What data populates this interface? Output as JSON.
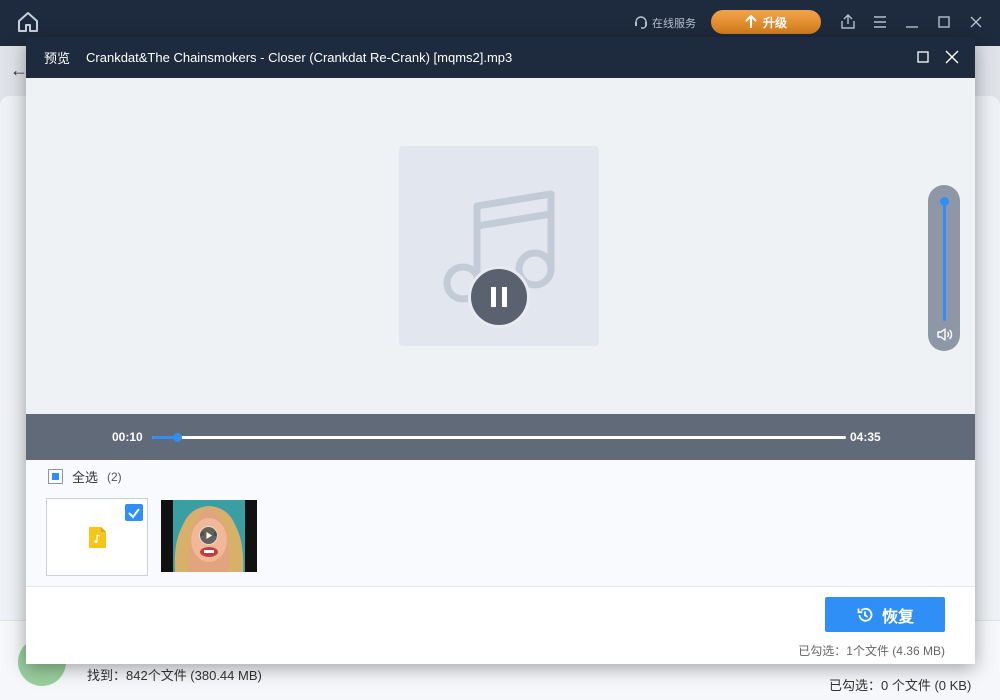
{
  "app": {
    "support_label": "在线服务",
    "upgrade_label": "升级",
    "found_label": "找到：842个文件 (380.44 MB)",
    "selected_label": "已勾选：0 个文件 (0 KB)"
  },
  "dialog": {
    "tag": "预览",
    "title": "Crankdat&The Chainsmokers - Closer (Crankdat Re-Crank) [mqms2].mp3",
    "player": {
      "current_time": "00:10",
      "total_time": "04:35",
      "progress_fraction": 0.036,
      "volume_fraction": 0.97,
      "state": "playing"
    },
    "select_all_label": "全选",
    "select_all_count": "(2)",
    "files": [
      {
        "type": "audio",
        "checked": true,
        "icon": "audio-file-icon"
      },
      {
        "type": "image",
        "checked": false,
        "icon": "play-icon"
      }
    ],
    "restore_label": "恢复",
    "selected_status": "已勾选：1个文件 (4.36 MB)"
  },
  "colors": {
    "accent": "#2f8ff7",
    "titlebar": "#1e2a3e",
    "upgrade": "#e08d2c",
    "seekbar_bg": "#606a78"
  }
}
